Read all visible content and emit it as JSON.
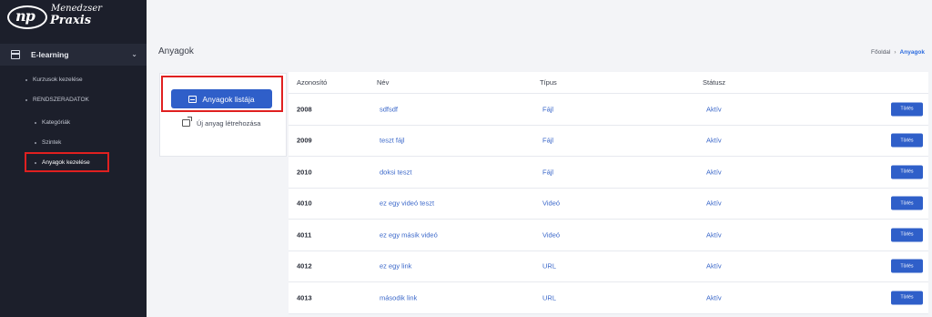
{
  "brand": {
    "mark": "np",
    "line1": "Menedzser",
    "line2": "Praxis"
  },
  "sidebar": {
    "section": "E-learning",
    "items": [
      {
        "label": "Kurzusok kezelése"
      },
      {
        "label": "RENDSZERADATOK"
      },
      {
        "label": "Kategóriák"
      },
      {
        "label": "Szintek"
      },
      {
        "label": "Anyagok kezelése"
      }
    ]
  },
  "header": {
    "title": "Anyagok",
    "breadcrumb": {
      "home": "Főoldal",
      "separator": "›",
      "current": "Anyagok"
    }
  },
  "card": {
    "list_button": "Anyagok listája",
    "new_item": "Új anyag létrehozása"
  },
  "table": {
    "columns": [
      "Azonosító",
      "Név",
      "Típus",
      "Státusz"
    ],
    "delete_label": "Törlés",
    "rows": [
      {
        "id": "2008",
        "name": "sdfsdf",
        "type": "Fájl",
        "status": "Aktív"
      },
      {
        "id": "2009",
        "name": "teszt fájl",
        "type": "Fájl",
        "status": "Aktív"
      },
      {
        "id": "2010",
        "name": "doksi teszt",
        "type": "Fájl",
        "status": "Aktív"
      },
      {
        "id": "4010",
        "name": "ez egy videó teszt",
        "type": "Videó",
        "status": "Aktív"
      },
      {
        "id": "4011",
        "name": "ez egy másik videó",
        "type": "Videó",
        "status": "Aktív"
      },
      {
        "id": "4012",
        "name": "ez egy link",
        "type": "URL",
        "status": "Aktív"
      },
      {
        "id": "4013",
        "name": "második link",
        "type": "URL",
        "status": "Aktív"
      }
    ]
  },
  "colors": {
    "sidebar_bg": "#1c1f2b",
    "accent": "#2f5fc9",
    "highlight": "#e02020",
    "link": "#3a67c9"
  }
}
